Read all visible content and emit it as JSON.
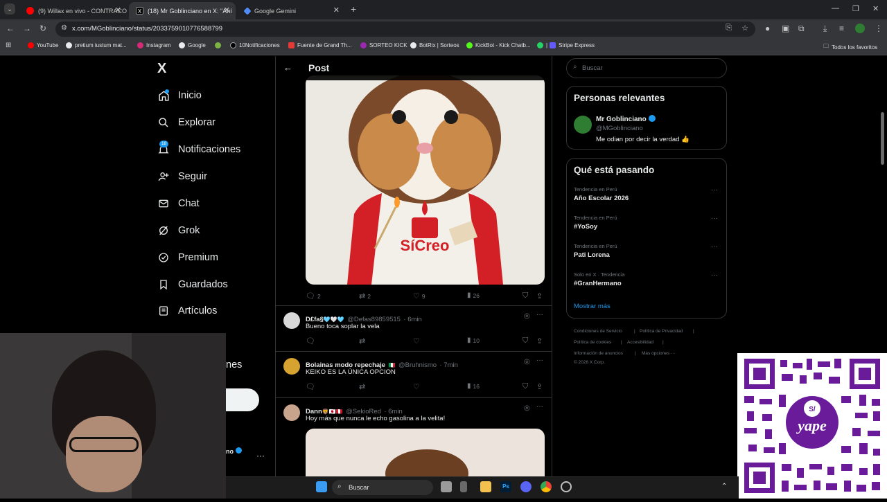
{
  "browser": {
    "tabs": [
      {
        "label": "(9) Willax en vivo - CONTRACO",
        "color": "#ff0000"
      },
      {
        "label": "(18) Mr Goblinciano en X: \"Ahí",
        "color": "#ffffff"
      },
      {
        "label": "Google Gemini",
        "color": "#4f8df5"
      }
    ],
    "new_tab": "+",
    "url": "x.com/MGoblinciano/status/2033759010776588799",
    "bookmarks": [
      "YouTube",
      "pretium iustum mat...",
      "Instagram",
      "Google",
      "10Notificaciones",
      "Fuente de Grand Th...",
      "SORTEO KICK",
      "BotRix | Sorteos",
      "KickBot - Kick Chatb...",
      "|",
      "Stripe Express"
    ],
    "all_favorites": "Todos los favoritos"
  },
  "nav": {
    "logo": "X",
    "items": [
      {
        "label": "Inicio",
        "icon": "home-icon"
      },
      {
        "label": "Explorar",
        "icon": "search-icon"
      },
      {
        "label": "Notificaciones",
        "icon": "bell-icon",
        "badge": "18"
      },
      {
        "label": "Seguir",
        "icon": "person-add-icon"
      },
      {
        "label": "Chat",
        "icon": "mail-icon"
      },
      {
        "label": "Grok",
        "icon": "grok-icon"
      },
      {
        "label": "Premium",
        "icon": "verified-icon"
      },
      {
        "label": "Guardados",
        "icon": "bookmark-icon"
      },
      {
        "label": "Artículos",
        "icon": "article-icon"
      }
    ],
    "hidden_item_fragment": "nes",
    "profile_fragment": "no",
    "more_dots": "···"
  },
  "post": {
    "header": "Post",
    "image_text": "SíCreo",
    "stats": {
      "replies": "2",
      "reposts": "2",
      "likes": "9",
      "views": "26"
    }
  },
  "replies": [
    {
      "name": "D£fa§",
      "emoji": "🩵🤍🩵",
      "handle": "@Defas89859515",
      "time": "· 6min",
      "text": "Bueno toca soplar la vela",
      "views": "10",
      "avatar": "#d9d9d9"
    },
    {
      "name": "Bolainas modo repechaje",
      "emoji": "🇮🇹",
      "handle": "@Bruhnismo",
      "time": "· 7min",
      "text": "KEIKO ES LA ÚNICA OPCION",
      "views": "16",
      "avatar": "#d6a330"
    },
    {
      "name": "Dann",
      "emoji": "🦁🇯🇵🇵🇪",
      "handle": "@SekioRed",
      "time": "· 6min",
      "text": "Hoy más que nunca le echo gasolina a la velita!",
      "views": "",
      "avatar": "#c8a48c"
    }
  ],
  "right": {
    "search_placeholder": "Buscar",
    "relevant_title": "Personas relevantes",
    "person": {
      "name": "Mr Goblinciano",
      "handle": "@MGoblinciano",
      "bio": "Me odian por decir la verdad 👍"
    },
    "trends_title": "Qué está pasando",
    "trends": [
      {
        "category": "Tendencia en Perú",
        "name": "Año Escolar 2026"
      },
      {
        "category": "Tendencia en Perú",
        "name": "#YoSoy"
      },
      {
        "category": "Tendencia en Perú",
        "name": "Pati Lorena"
      },
      {
        "category": "Solo en X · Tendencia",
        "name": "#GranHermano"
      }
    ],
    "show_more": "Mostrar más",
    "footer": [
      "Condiciones de Servicio",
      "|",
      "Política de Privacidad",
      "|",
      "Política de cookies",
      "|",
      "Accesibilidad",
      "|",
      "Información de anuncios",
      "|",
      "Más opciones ···",
      "© 2026 X Corp."
    ]
  },
  "taskbar": {
    "search": "Buscar"
  },
  "overlay": {
    "qr_brand": "yape",
    "qr_logo": "S/"
  },
  "colors": {
    "accent": "#1d9bf0",
    "qr": "#6a1b9a"
  }
}
